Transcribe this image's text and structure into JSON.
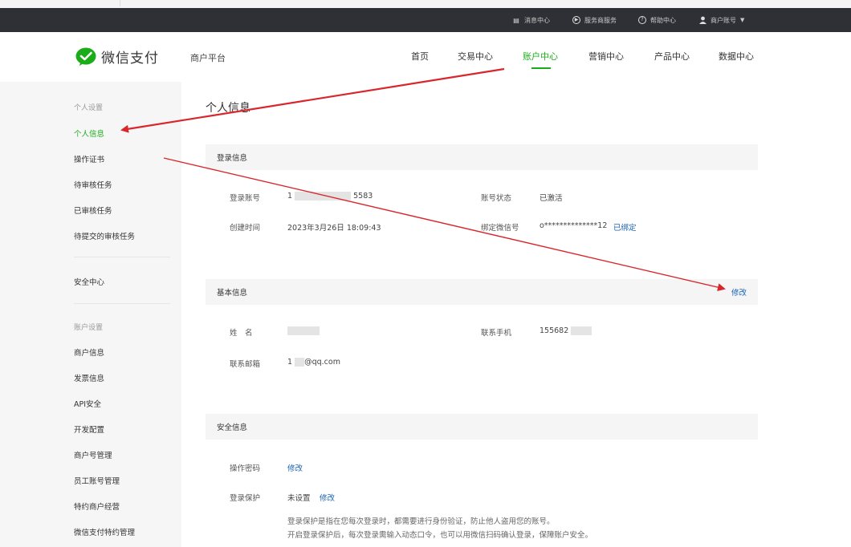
{
  "topbar": {
    "items": [
      {
        "icon": "message-icon",
        "label": "消息中心"
      },
      {
        "icon": "service-icon",
        "label": "服务商服务"
      },
      {
        "icon": "help-icon",
        "label": "帮助中心"
      },
      {
        "icon": "user-icon",
        "label": "商户账号"
      }
    ]
  },
  "header": {
    "brand": "微信支付",
    "subtitle": "商户平台",
    "nav": [
      "首页",
      "交易中心",
      "账户中心",
      "营销中心",
      "产品中心",
      "数据中心"
    ],
    "active_nav": "账户中心"
  },
  "sidebar": {
    "groups": [
      {
        "title": "个人设置",
        "items": [
          "个人信息",
          "操作证书",
          "待审核任务",
          "已审核任务",
          "待提交的审核任务"
        ]
      },
      {
        "title": "",
        "items": [
          "安全中心"
        ]
      },
      {
        "title": "账户设置",
        "items": [
          "商户信息",
          "发票信息",
          "API安全",
          "开发配置",
          "商户号管理",
          "员工账号管理",
          "特约商户经营",
          "微信支付特约管理"
        ]
      }
    ],
    "active_item": "个人信息"
  },
  "main": {
    "title": "个人信息",
    "login_section": {
      "title": "登录信息",
      "login_account_label": "登录账号",
      "login_account_prefix": "1",
      "login_account_suffix": "5583",
      "account_status_label": "账号状态",
      "account_status_value": "已激活",
      "created_time_label": "创建时间",
      "created_time_value": "2023年3月26日 18:09:43",
      "bind_wechat_label": "绑定微信号",
      "bind_wechat_value": "o**************12",
      "bind_wechat_link": "已绑定"
    },
    "basic_section": {
      "title": "基本信息",
      "edit_label": "修改",
      "name_label": "姓　名",
      "phone_label": "联系手机",
      "phone_value": "155682",
      "email_label": "联系邮箱",
      "email_prefix": "1",
      "email_suffix": "@qq.com"
    },
    "security_section": {
      "title": "安全信息",
      "password_label": "操作密码",
      "password_link": "修改",
      "question_label": "登录保护",
      "question_value": "未设置",
      "question_link": "修改",
      "desc_line1": "登录保护是指在您每次登录时，都需要进行身份验证，防止他人盗用您的账号。",
      "desc_line2": "开启登录保护后，每次登录需输入动态口令，也可以用微信扫码确认登录，保障账户安全。"
    }
  }
}
